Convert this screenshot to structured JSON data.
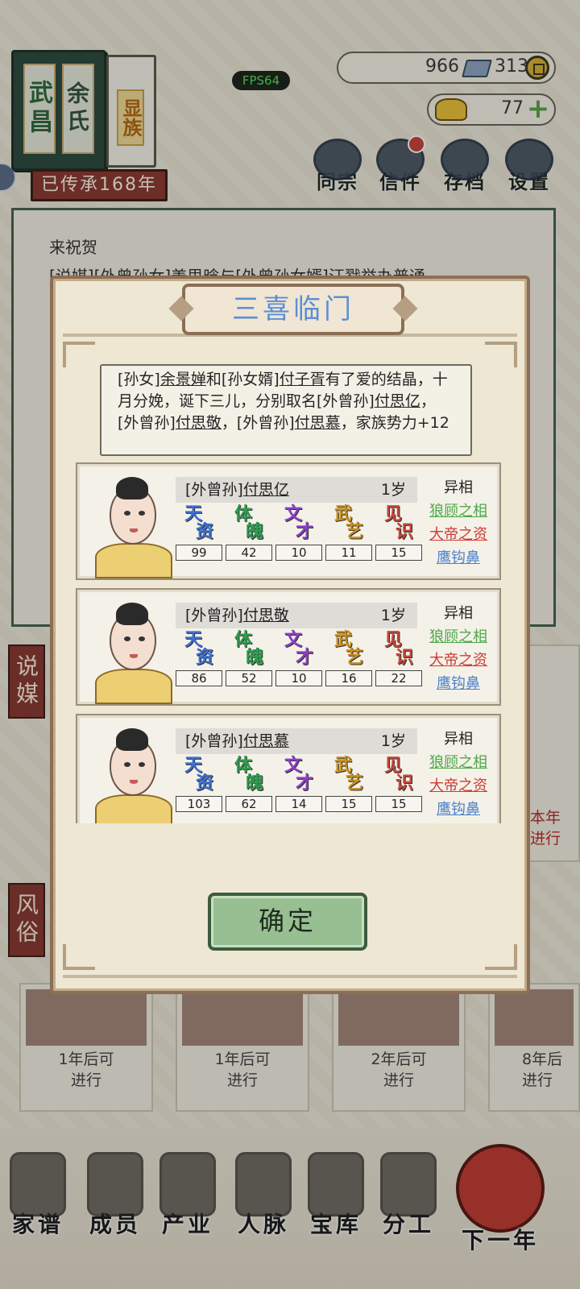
{
  "clan": {
    "name_main": "武昌",
    "name_family": "余氏",
    "title_badge": "显族",
    "legacy": "已传承168年"
  },
  "fps": "FPS64",
  "currency": {
    "silver": "966",
    "copper": "313",
    "gold": "77"
  },
  "top_menu": [
    "同宗",
    "信件",
    "存档",
    "设置"
  ],
  "background_panel": {
    "line1": "来祝贺",
    "line2": "[说媒][外曾孙女]姜思晗与[外曾孙女婿]汪戮举办普通"
  },
  "side_labels": [
    "说媒",
    "风俗"
  ],
  "activity_cards": [
    {
      "line1": "1年后可",
      "line2": "进行"
    },
    {
      "line1": "1年后可",
      "line2": "进行"
    },
    {
      "line1": "2年后可",
      "line2": "进行"
    },
    {
      "line1": "8年后",
      "line2": "进行"
    }
  ],
  "right_card": {
    "line1": "本年",
    "line2": "进行"
  },
  "bottom_nav": [
    "家谱",
    "成员",
    "产业",
    "人脉",
    "宝库",
    "分工",
    "下一年"
  ],
  "bottom_nav_icons": [
    "family-tree-icon",
    "members-icon",
    "property-icon",
    "network-icon",
    "treasury-icon",
    "division-icon",
    "lantern-icon"
  ],
  "modal": {
    "title": "三喜临门",
    "description": {
      "p1": "[孙女]",
      "n1": "余景婵",
      "p2": "和[孙女婿]",
      "n2": "付子胥",
      "p3": "有了爱的结晶，十月分娩，诞下三儿，分别取名[外曾孙]",
      "n3": "付思亿",
      "p4": "，[外曾孙]",
      "n4": "付思敬",
      "p5": "，[外曾孙]",
      "n5": "付思慕",
      "p6": "，家族势力+12"
    },
    "stat_labels": [
      {
        "a": "天",
        "b": "资",
        "color": "#3d6fd1"
      },
      {
        "a": "体",
        "b": "魄",
        "color": "#2e9c4f"
      },
      {
        "a": "文",
        "b": "才",
        "color": "#8a3fc4"
      },
      {
        "a": "武",
        "b": "艺",
        "color": "#c98f1d"
      },
      {
        "a": "见",
        "b": "识",
        "color": "#c6453a"
      }
    ],
    "traits_header": "异相",
    "trait_colors": [
      "#4fa94b",
      "#d03a33",
      "#4e82cc"
    ],
    "children": [
      {
        "relation": "[外曾孙]",
        "name": "付思亿",
        "age": "1岁",
        "stats": [
          "99",
          "42",
          "10",
          "11",
          "15"
        ],
        "traits": [
          "狼顾之相",
          "大帝之资",
          "鹰钩鼻"
        ]
      },
      {
        "relation": "[外曾孙]",
        "name": "付思敬",
        "age": "1岁",
        "stats": [
          "86",
          "52",
          "10",
          "16",
          "22"
        ],
        "traits": [
          "狼顾之相",
          "大帝之资",
          "鹰钩鼻"
        ]
      },
      {
        "relation": "[外曾孙]",
        "name": "付思慕",
        "age": "1岁",
        "stats": [
          "103",
          "62",
          "14",
          "15",
          "15"
        ],
        "traits": [
          "狼顾之相",
          "大帝之资",
          "鹰钩鼻"
        ]
      }
    ],
    "confirm_label": "确定"
  }
}
